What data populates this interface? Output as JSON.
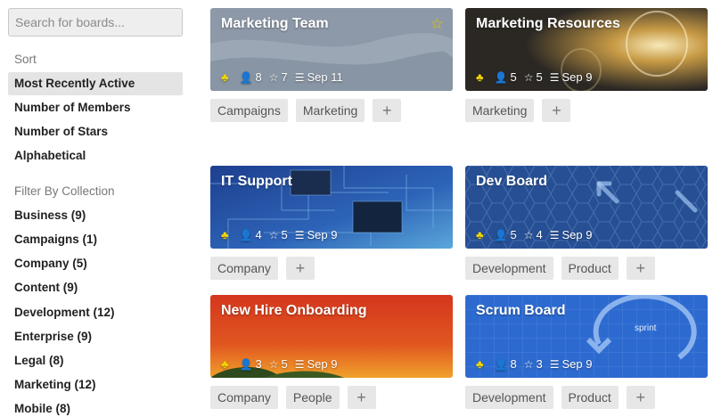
{
  "search": {
    "placeholder": "Search for boards..."
  },
  "sort": {
    "label": "Sort",
    "options": [
      "Most Recently Active",
      "Number of Members",
      "Number of Stars",
      "Alphabetical"
    ],
    "active": "Most Recently Active"
  },
  "filter": {
    "label": "Filter By Collection",
    "collections": [
      "Business (9)",
      "Campaigns (1)",
      "Company (5)",
      "Content (9)",
      "Development (12)",
      "Enterprise (9)",
      "Legal (8)",
      "Marketing (12)",
      "Mobile (8)"
    ]
  },
  "boards": [
    {
      "title": "Marketing Team",
      "starred": true,
      "star_icon": "star-filled-icon",
      "members": "8",
      "stars": "7",
      "date": "Sep 11",
      "tags": [
        "Campaigns",
        "Marketing"
      ]
    },
    {
      "title": "Marketing Resources",
      "starred": false,
      "members": "5",
      "stars": "5",
      "date": "Sep 9",
      "tags": [
        "Marketing"
      ]
    },
    {
      "title": "IT Support",
      "starred": false,
      "members": "4",
      "stars": "5",
      "date": "Sep 9",
      "tags": [
        "Company"
      ]
    },
    {
      "title": "Dev Board",
      "starred": false,
      "members": "5",
      "stars": "4",
      "date": "Sep 9",
      "tags": [
        "Development",
        "Product"
      ]
    },
    {
      "title": "New Hire Onboarding",
      "starred": false,
      "members": "3",
      "stars": "5",
      "date": "Sep 9",
      "tags": [
        "Company",
        "People"
      ]
    },
    {
      "title": "Scrum Board",
      "starred": false,
      "members": "8",
      "stars": "3",
      "date": "Sep 9",
      "tags": [
        "Development",
        "Product"
      ],
      "background_text": "sprint"
    }
  ],
  "add_tag_label": "+",
  "colors": {
    "star": "#e8c300",
    "org_icon": "#f2d400",
    "tag_bg": "#e7e7e7",
    "active_sort_bg": "#e4e4e4"
  }
}
